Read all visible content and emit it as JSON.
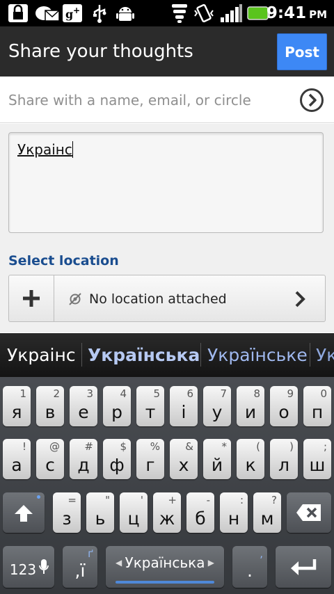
{
  "status_bar": {
    "time": "9:41",
    "ampm": "PM",
    "icons": [
      "lock-icon",
      "yahoo-mail-icon",
      "google-plus-icon",
      "usb-icon",
      "android-debug-icon",
      "wifi-icon",
      "vibrate-icon",
      "signal-icon",
      "battery-icon"
    ]
  },
  "header": {
    "title": "Share your thoughts",
    "post_label": "Post",
    "accent": "#3d88f5"
  },
  "share": {
    "placeholder": "Share with a name, email, or circle"
  },
  "post": {
    "text": "Украінс"
  },
  "location": {
    "label": "Select location",
    "status": "No location attached",
    "label_color": "#1a4d8f"
  },
  "suggestions": {
    "items": [
      "Украінс",
      "Українська",
      "Українське",
      "Ук"
    ]
  },
  "keyboard": {
    "row1": [
      {
        "main": "я",
        "hint": "1"
      },
      {
        "main": "в",
        "hint": "2"
      },
      {
        "main": "е",
        "hint": "3"
      },
      {
        "main": "р",
        "hint": "4"
      },
      {
        "main": "т",
        "hint": "5"
      },
      {
        "main": "і",
        "hint": "6"
      },
      {
        "main": "у",
        "hint": "7"
      },
      {
        "main": "и",
        "hint": "8"
      },
      {
        "main": "о",
        "hint": "9"
      },
      {
        "main": "п",
        "hint": "0"
      }
    ],
    "row2": [
      {
        "main": "а",
        "hint": "!"
      },
      {
        "main": "с",
        "hint": "@"
      },
      {
        "main": "д",
        "hint": "#"
      },
      {
        "main": "ф",
        "hint": "$"
      },
      {
        "main": "г",
        "hint": "%"
      },
      {
        "main": "х",
        "hint": "&"
      },
      {
        "main": "й",
        "hint": "*"
      },
      {
        "main": "к",
        "hint": "("
      },
      {
        "main": "л",
        "hint": ")"
      },
      {
        "main": "ш",
        "hint": ";"
      }
    ],
    "row3": [
      {
        "main": "з",
        "hint": "="
      },
      {
        "main": "ь",
        "hint": "\""
      },
      {
        "main": "ц",
        "hint": "'"
      },
      {
        "main": "ж",
        "hint": "+"
      },
      {
        "main": "б",
        "hint": "-"
      },
      {
        "main": "н",
        "hint": ":"
      },
      {
        "main": "м",
        "hint": "?"
      }
    ],
    "symbols_label": "123",
    "comma_key": ",ї",
    "comma_hint": "ґ",
    "space_label": "Українська",
    "period_key": ".",
    "period_hint": ","
  }
}
